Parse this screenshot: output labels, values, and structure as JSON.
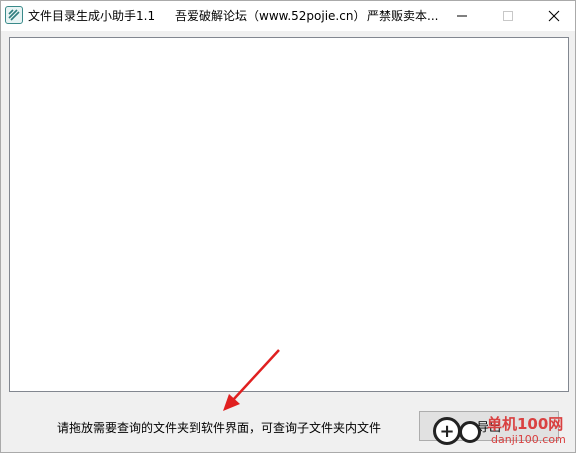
{
  "window": {
    "title_app": "文件目录生成小助手1.1",
    "title_forum": "吾爱破解论坛（www.52pojie.cn）",
    "title_notice": "严禁贩卖本..."
  },
  "main": {
    "hint_text": "请拖放需要查询的文件夹到软件界面，可查询子文件夹内文件",
    "export_button_label": "导出"
  },
  "watermark": {
    "brand": "单机100网",
    "url": "danji100.com"
  },
  "colors": {
    "arrow": "#e02020",
    "watermark": "#d94040"
  }
}
